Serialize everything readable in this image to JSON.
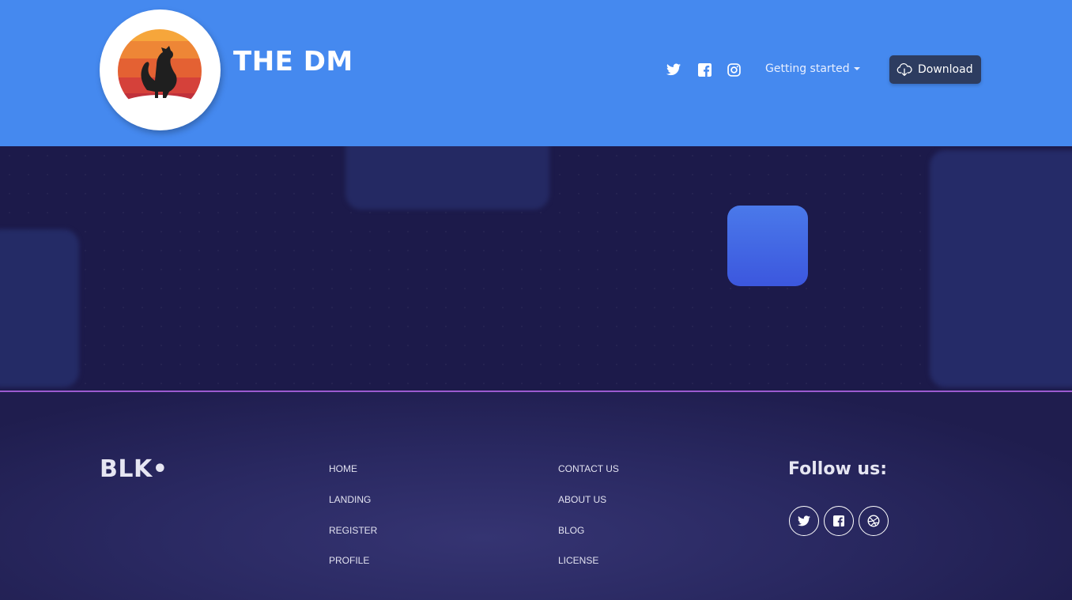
{
  "header": {
    "title": "THE DM",
    "background": "#4589ef",
    "nav": {
      "social_icons": [
        "twitter-icon",
        "facebook-icon",
        "instagram-icon"
      ],
      "getting_started": "Getting started",
      "download": "Download"
    }
  },
  "footer": {
    "brand": "BLK•",
    "links_col1": [
      "HOME",
      "LANDING",
      "REGISTER",
      "PROFILE"
    ],
    "links_col2": [
      "CONTACT US",
      "ABOUT US",
      "BLOG",
      "LICENSE"
    ],
    "follow_title": "Follow us:",
    "social_icons": [
      "twitter-icon",
      "facebook-icon",
      "dribbble-icon"
    ]
  },
  "colors": {
    "accent": "#4589ef",
    "hero_bg": "#1c1a4a",
    "divider": "#9b5bd0",
    "button_dark": "#2d3c60"
  }
}
